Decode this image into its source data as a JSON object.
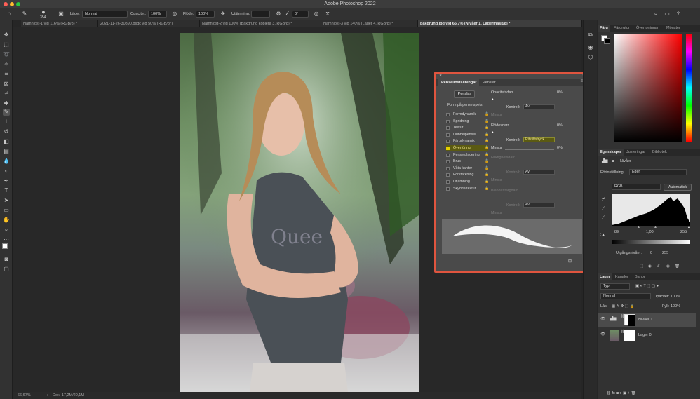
{
  "app": {
    "title": "Adobe Photoshop 2022"
  },
  "options": {
    "brush_size": "354",
    "mode_label": "Läge:",
    "mode_value": "Normal",
    "opacity_label": "Opacitet:",
    "opacity_value": "100%",
    "flow_label": "Flöde:",
    "flow_value": "100%",
    "smoothing_label": "Utjämning:",
    "angle_value": "0°"
  },
  "tabs": [
    {
      "label": "Namnlöst-1 vid 116% (RGB/8) *"
    },
    {
      "label": "2021-11-26-30890.psdc vid 50% (RGB/8*)"
    },
    {
      "label": "Namnlöst-2 vid 100% (Bakgrund kopiera 3, RGB/8) *"
    },
    {
      "label": "Namnlöst-3 vid 140% (Lager 4, RGB/8) *"
    },
    {
      "label": "bakgrund.jpg vid 66,7% (Nivåer 1, Lagermask/8) *"
    }
  ],
  "status": {
    "zoom": "66,67%",
    "doc": "Dok: 17,2M/20,1M"
  },
  "brush_panel": {
    "tab_settings": "Penselinställningar",
    "tab_brushes": "Penslar",
    "brushes_button": "Penslar",
    "tip_shape": "Form på penselspets",
    "items": [
      "Formdynamik",
      "Spridning",
      "Textur",
      "Dubbelpensel",
      "Färgdynamik",
      "Överföring",
      "Penselplacering",
      "Brus",
      "Våta kanter",
      "Förstärkning",
      "Utjämning",
      "Skydda textur"
    ],
    "opacity_jitter": "Opacitetsdarr",
    "opacity_jitter_val": "0%",
    "control": "Kontroll:",
    "control_off": "Av",
    "minimum": "Minsta",
    "flow_jitter": "Flödesdarr",
    "flow_jitter_val": "0%",
    "control_pen": "Ritstiftstryck",
    "minimum_val": "0%",
    "wetness_jitter": "Fuktighetsdarr",
    "mix_jitter": "Blandat färgdarr",
    "control_off2": "Av",
    "control_off3": "Av",
    "minimum2": "Minsta",
    "minimum3": "Minsta"
  },
  "color_panel": {
    "tabs": [
      "Färg",
      "Färgrutor",
      "Övertoningar",
      "Mönster"
    ]
  },
  "properties": {
    "tabs": [
      "Egenskaper",
      "Justeringar",
      "Bibliotek"
    ],
    "title": "Nivåer",
    "preset_label": "Förinställning:",
    "preset_value": "Egen",
    "channel": "RGB",
    "auto": "Automatisk",
    "in_black": "89",
    "in_gamma": "1,00",
    "in_white": "255",
    "out_label": "Utgångsnivåer:",
    "out_black": "0",
    "out_white": "255"
  },
  "layers": {
    "tabs": [
      "Lager",
      "Kanaler",
      "Banor"
    ],
    "filter": "Typ",
    "blend": "Normal",
    "opacity_label": "Opacitet:",
    "opacity_value": "100%",
    "lock_label": "Lås:",
    "fill_label": "Fyll:",
    "fill_value": "100%",
    "items": [
      {
        "name": "Nivåer 1"
      },
      {
        "name": "Lager 0"
      }
    ]
  }
}
